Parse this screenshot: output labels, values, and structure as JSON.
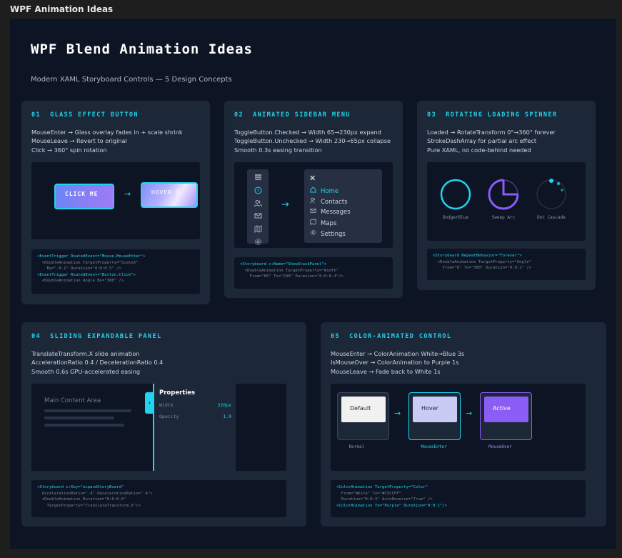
{
  "window": {
    "title": "WPF Animation Ideas"
  },
  "header": {
    "title": "WPF Blend Animation Ideas",
    "subtitle": "Modern XAML Storyboard Controls — 5 Design Concepts"
  },
  "cards": {
    "glass": {
      "title": "01  GLASS EFFECT BUTTON",
      "desc": [
        "MouseEnter → Glass overlay fades in + scale shrink",
        "MouseLeave → Revert to original",
        "Click → 360° spin rotation"
      ],
      "button_normal": "CLICK ME",
      "button_hover": "HOVER Ò",
      "code": [
        "<EventTrigger RoutedEvent=\"Mouse.MouseEnter\">",
        "  <DoubleAnimation TargetProperty=\"ScaleX\"",
        "    By=\"-0.1\" Duration=\"0:0:0.5\" />",
        "<EventTrigger RoutedEvent=\"Button.Click\">",
        "  <DoubleAnimation Angle By=\"360\" />"
      ]
    },
    "sidebar": {
      "title": "02  ANIMATED SIDEBAR MENU",
      "desc": [
        "ToggleButton.Checked → Width 65→230px expand",
        "ToggleButton.Unchecked → Width 230→65px collapse",
        "Smooth 0.3s easing transition"
      ],
      "close_glyph": "✕",
      "items": [
        {
          "label": "Home",
          "icon": "home-icon"
        },
        {
          "label": "Contacts",
          "icon": "contacts-icon"
        },
        {
          "label": "Messages",
          "icon": "mail-icon"
        },
        {
          "label": "Maps",
          "icon": "map-icon"
        },
        {
          "label": "Settings",
          "icon": "gear-icon"
        }
      ],
      "code": [
        "<Storyboard x:Name=\"ShowStackPanel\">",
        "  <DoubleAnimation TargetProperty=\"Width\"",
        "    From=\"65\" To=\"230\" Duration=\"0:0:0.3\"/>"
      ]
    },
    "spinner": {
      "title": "03  ROTATING LOADING SPINNER",
      "desc": [
        "Loaded → RotateTransform 0°→360° forever",
        "StrokeDashArray for partial arc effect",
        "Pure XAML, no code-behind needed"
      ],
      "labels": [
        "DodgerBlue",
        "Sweep Arc",
        "Dot Cascade"
      ],
      "colors": {
        "ring": "#22d3ee",
        "arc": "#8b5cf6"
      },
      "code": [
        "<Storyboard RepeatBehavior=\"Forever\">",
        "  <DoubleAnimation TargetProperty=\"Angle\"",
        "    From=\"0\" To=\"360\" Duration=\"0:0:1\" />"
      ]
    },
    "panel": {
      "title": "04  SLIDING EXPANDABLE PANEL",
      "desc": [
        "TranslateTransform.X slide animation",
        "AccelerationRatio 0.4 / DecelerationRatio 0.4",
        "Smooth 0.6s GPU-accelerated easing"
      ],
      "content_label": "Main Content Area",
      "tab_glyph": "‹",
      "properties_title": "Properties",
      "props": [
        {
          "name": "Width",
          "value": "320px"
        },
        {
          "name": "Opacity",
          "value": "1.0"
        }
      ],
      "code": [
        "<Storyboard x:Key=\"expandStoryBoard\"",
        "  AccelerationRatio=\".4\" DecelerationRatio=\".4\">",
        "  <DoubleAnimation Duration=\"0:0:0.6\"",
        "    TargetProperty=\"TranslateTransform.X\"/>"
      ]
    },
    "color": {
      "title": "05  COLOR-ANIMATED CONTROL",
      "desc": [
        "MouseEnter → ColorAnimation White→Blue 3s",
        "IsMouseOver → ColorAnimation to Purple 1s",
        "MouseLeave → Fade back to White 1s"
      ],
      "states": [
        {
          "label": "Default",
          "caption": "Normal",
          "fill": "#f1f1f1",
          "text": "#1c2738",
          "border": "#3a4659",
          "captionColor": "#8b95a3"
        },
        {
          "label": "Hover",
          "caption": "MouseEnter",
          "fill": "#c9cbf5",
          "text": "#1c2738",
          "border": "#22d3ee",
          "captionColor": "#22d3ee"
        },
        {
          "label": "Active",
          "caption": "MouseOver",
          "fill": "#8b5cf6",
          "text": "#ffffff",
          "border": "#8b5cf6",
          "captionColor": "#a78bfa"
        }
      ],
      "code": [
        "<ColorAnimation TargetProperty=\"Color\"",
        "  From=\"White\" To=\"#C5CCFF\"",
        "  Duration=\"0:0:3\" AutoReverse=\"True\" />",
        "<ColorAnimation To=\"Purple\" Duration=\"0:0:1\"/>"
      ]
    }
  },
  "arrow_glyph": "→"
}
